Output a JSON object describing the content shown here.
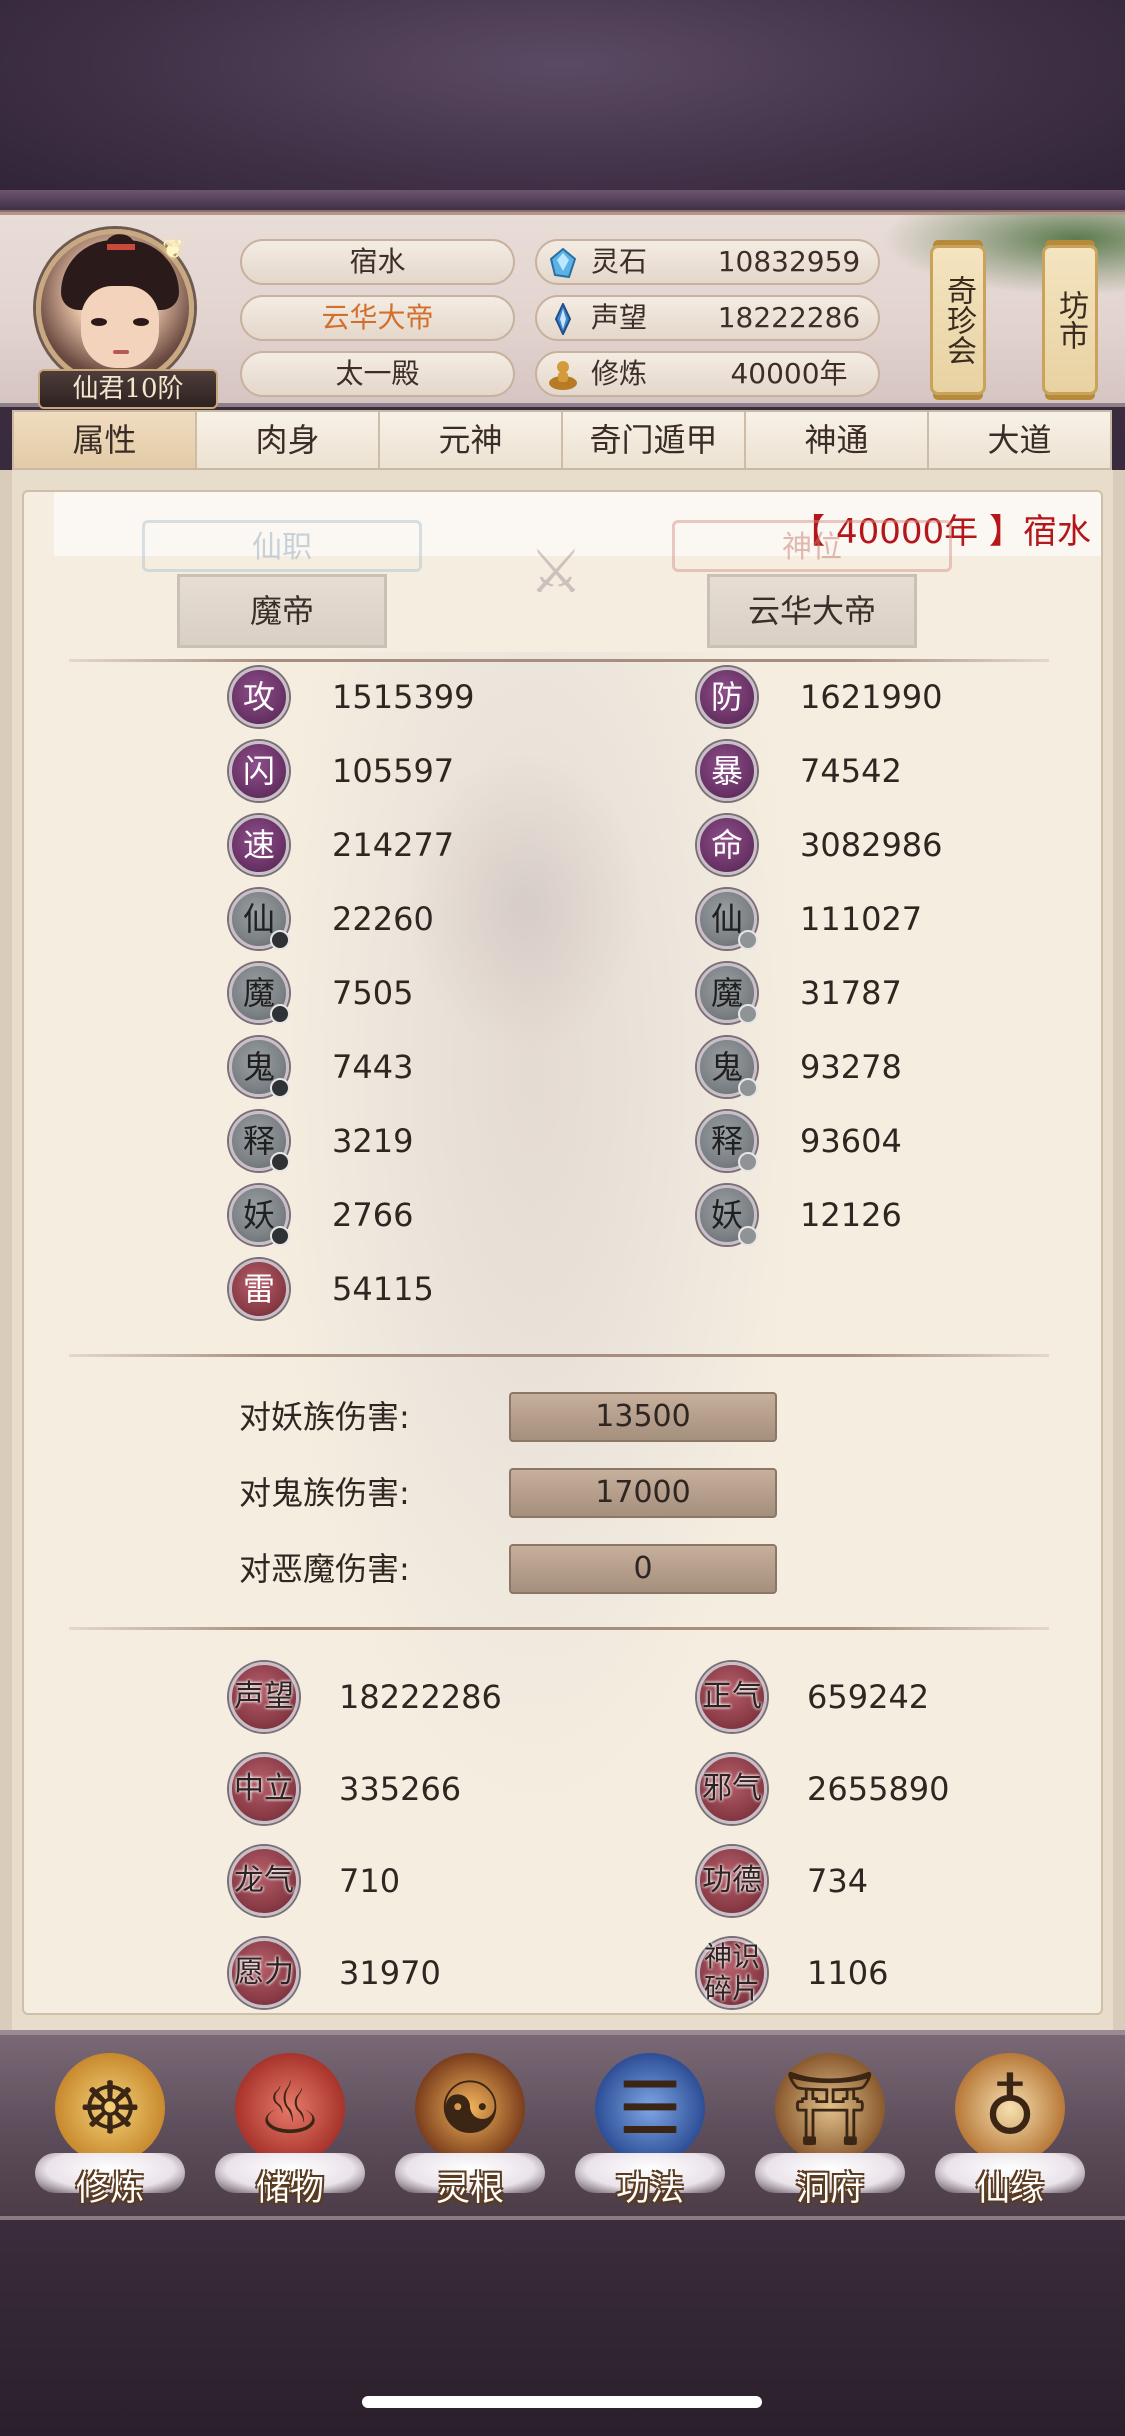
{
  "header": {
    "player_name": "宿水",
    "player_title": "云华大帝",
    "sect": "太一殿",
    "rank_label": "仙君10阶",
    "resources": [
      {
        "label": "灵石",
        "value": "10832959",
        "icon": "spirit-stone-icon"
      },
      {
        "label": "声望",
        "value": "18222286",
        "icon": "reputation-crystal-icon"
      },
      {
        "label": "修炼",
        "value": "40000年",
        "icon": "meditation-icon"
      }
    ],
    "scroll_buttons": [
      "奇珍会",
      "坊市"
    ]
  },
  "tabs": [
    {
      "label": "属性",
      "active": true
    },
    {
      "label": "肉身",
      "active": false
    },
    {
      "label": "元神",
      "active": false
    },
    {
      "label": "奇门遁甲",
      "active": false
    },
    {
      "label": "神通",
      "active": false
    },
    {
      "label": "大道",
      "active": false
    }
  ],
  "notice": "【 40000年 】宿水",
  "posts": {
    "immortal_post": {
      "label": "仙职",
      "value": "魔帝"
    },
    "divine_post": {
      "label": "神位",
      "value": "云华大帝"
    }
  },
  "stats_left": [
    {
      "char": "攻",
      "value": "1515399",
      "style": "purple"
    },
    {
      "char": "闪",
      "value": "105597",
      "style": "purple"
    },
    {
      "char": "速",
      "value": "214277",
      "style": "purple"
    },
    {
      "char": "仙",
      "value": "22260",
      "style": "gray-dot"
    },
    {
      "char": "魔",
      "value": "7505",
      "style": "gray-dot"
    },
    {
      "char": "鬼",
      "value": "7443",
      "style": "gray-dot"
    },
    {
      "char": "释",
      "value": "3219",
      "style": "gray-dot"
    },
    {
      "char": "妖",
      "value": "2766",
      "style": "gray-dot"
    },
    {
      "char": "雷",
      "value": "54115",
      "style": "red"
    }
  ],
  "stats_right": [
    {
      "char": "防",
      "value": "1621990",
      "style": "purple"
    },
    {
      "char": "暴",
      "value": "74542",
      "style": "purple"
    },
    {
      "char": "命",
      "value": "3082986",
      "style": "purple"
    },
    {
      "char": "仙",
      "value": "111027",
      "style": "gray-ring"
    },
    {
      "char": "魔",
      "value": "31787",
      "style": "gray-ring"
    },
    {
      "char": "鬼",
      "value": "93278",
      "style": "gray-ring"
    },
    {
      "char": "释",
      "value": "93604",
      "style": "gray-ring"
    },
    {
      "char": "妖",
      "value": "12126",
      "style": "gray-ring"
    }
  ],
  "damage": [
    {
      "label": "对妖族伤害:",
      "value": "13500"
    },
    {
      "label": "对鬼族伤害:",
      "value": "17000"
    },
    {
      "label": "对恶魔伤害:",
      "value": "0"
    }
  ],
  "misc_left": [
    {
      "label": "声望",
      "value": "18222286"
    },
    {
      "label": "中立",
      "value": "335266"
    },
    {
      "label": "龙气",
      "value": "710"
    },
    {
      "label": "愿力",
      "value": "31970"
    }
  ],
  "misc_right": [
    {
      "label": "正气",
      "value": "659242"
    },
    {
      "label": "邪气",
      "value": "2655890"
    },
    {
      "label": "功德",
      "value": "734"
    },
    {
      "label": "神识碎片",
      "value": "1106"
    }
  ],
  "bottom_nav": [
    {
      "label": "修炼",
      "icon": "cultivation-icon"
    },
    {
      "label": "储物",
      "icon": "storage-bag-icon"
    },
    {
      "label": "灵根",
      "icon": "spirit-root-icon"
    },
    {
      "label": "功法",
      "icon": "technique-book-icon"
    },
    {
      "label": "洞府",
      "icon": "cave-dwelling-icon"
    },
    {
      "label": "仙缘",
      "icon": "immortal-fate-icon"
    }
  ],
  "colors": {
    "accent_title": "#d2702b",
    "notice_red": "#b4161a",
    "stat_purple": "#6b3468",
    "stat_red": "#8c3d48"
  }
}
